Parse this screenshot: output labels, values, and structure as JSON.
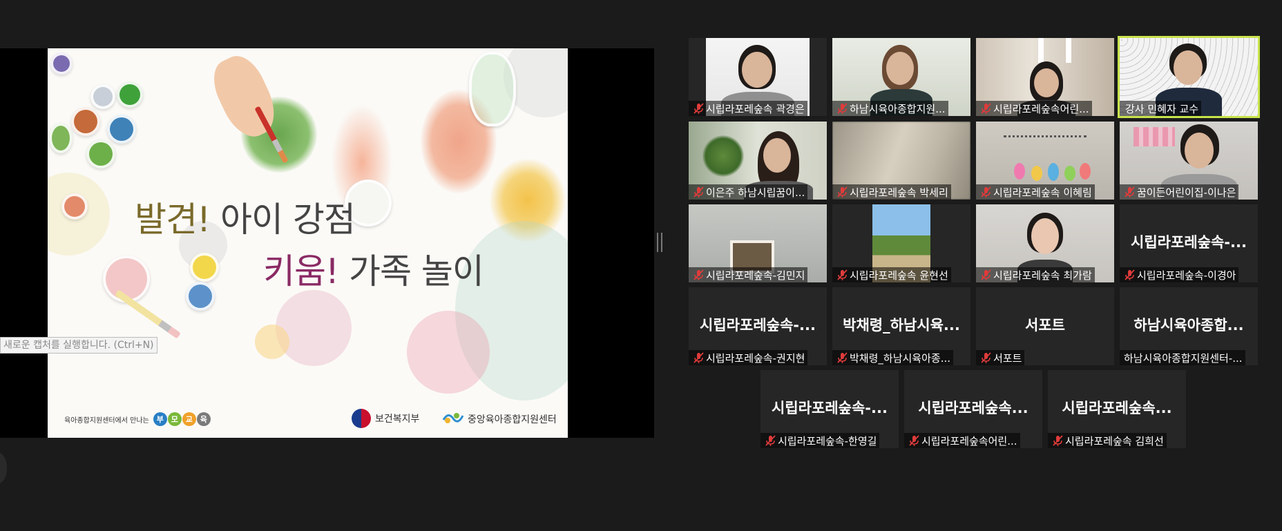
{
  "slide": {
    "title_line1_part1": "발견!",
    "title_line1_part2": "아이 강점",
    "title_line2_part1": "키움!",
    "title_line2_part2": "가족 놀이",
    "footer_left_text": "육아종합지원센터에서 만나는",
    "footer_badges": [
      "부",
      "모",
      "교",
      "육"
    ],
    "logo_mohw": "보건복지부",
    "logo_center": "중앙육아종합지원센터"
  },
  "tooltip": "새로운 캡처를 실행합니다. (Ctrl+N)",
  "participants": [
    {
      "name": "시립라포레숲속 곽경은",
      "muted": true,
      "video": true
    },
    {
      "name": "하남시육아종합지원...",
      "muted": true,
      "video": true
    },
    {
      "name": "시립라포레숲속어린...",
      "muted": true,
      "video": true
    },
    {
      "name": "강사 민혜자 교수",
      "muted": false,
      "video": true,
      "active_speaker": true
    },
    {
      "name": "이은주 하남시립꿈이...",
      "muted": true,
      "video": true
    },
    {
      "name": "시립라포레숲속 박세리",
      "muted": true,
      "video": true
    },
    {
      "name": "시립라포레숲속 이혜림",
      "muted": true,
      "video": true
    },
    {
      "name": "꿈이든어린이집-이나은",
      "muted": true,
      "video": true
    },
    {
      "name": "시립라포레숲속-김민지",
      "muted": true,
      "video": true
    },
    {
      "name": "시립라포레숲속 윤현선",
      "muted": true,
      "video": true
    },
    {
      "name": "시립라포레숲속 최가람",
      "muted": true,
      "video": true
    },
    {
      "name": "시립라포레숲속-이경아",
      "display": "시립라포레숲속-...",
      "muted": true,
      "video": false
    },
    {
      "name": "시립라포레숲속-권지현",
      "display": "시립라포레숲속-...",
      "muted": true,
      "video": false
    },
    {
      "name": "박채령_하남시육아종...",
      "display": "박채령_하남시육...",
      "muted": true,
      "video": false
    },
    {
      "name": "서포트",
      "display": "서포트",
      "muted": true,
      "video": false
    },
    {
      "name": "하남시육아종합지원센터-...",
      "display": "하남시육아종합...",
      "muted": false,
      "video": false
    },
    {
      "name": "시립라포레숲속-한영길",
      "display": "시립라포레숲속-...",
      "muted": true,
      "video": false
    },
    {
      "name": "시립라포레숲속어린...",
      "display": "시립라포레숲속...",
      "muted": true,
      "video": false
    },
    {
      "name": "시립라포레숲속 김희선",
      "display": "시립라포레숲속...",
      "muted": true,
      "video": false
    }
  ],
  "colors": {
    "active_border": "#c7e34b",
    "background": "#1b1b1b",
    "muted_icon": "#e03b3b"
  }
}
